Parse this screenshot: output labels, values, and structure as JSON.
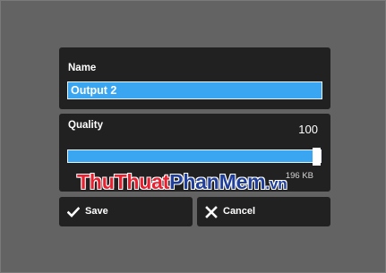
{
  "name_panel": {
    "label": "Name",
    "value": "Output 2"
  },
  "quality_panel": {
    "label": "Quality",
    "value_text": "100",
    "slider_value": 100,
    "slider_max": 100,
    "size_text": "196 KB"
  },
  "buttons": {
    "save_label": "Save",
    "save_icon": "checkmark-icon",
    "cancel_label": "Cancel",
    "cancel_icon": "close-icon"
  },
  "watermark": {
    "part1": "Thu",
    "part2": "Thuat",
    "part3": "Phan",
    "part4": "Mem",
    "part5": ".vn"
  },
  "colors": {
    "background": "#636363",
    "panel": "#212121",
    "accent": "#3aa6f2",
    "text": "#ffffff"
  }
}
